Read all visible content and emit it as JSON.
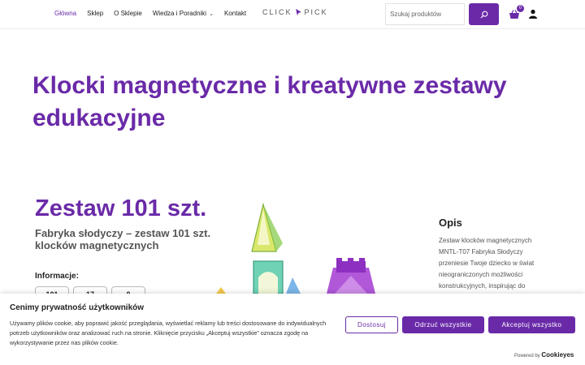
{
  "header": {
    "nav": [
      {
        "label": "Główna"
      },
      {
        "label": "Sklep"
      },
      {
        "label": "O Sklepie"
      },
      {
        "label": "Wiedza i Poradniki"
      },
      {
        "label": "Kontakt"
      }
    ],
    "logo_left": "CLICK",
    "logo_right": "PICK",
    "search_placeholder": "Szukaj produktów",
    "cart_count": "0",
    "accent_color": "#6a2aa8"
  },
  "hero": {
    "title": "Klocki magnetyczne i kreatywne zestawy edukacyjne"
  },
  "product": {
    "title": "Zestaw 101 szt.",
    "subtitle": "Fabryka słodyczy – zestaw 101 szt. klocków magnetycznych",
    "info_label": "Informacje:",
    "info_values": [
      "101",
      "17",
      "0"
    ]
  },
  "description": {
    "title": "Opis",
    "text": "Zestaw klocków magnetycznych MNTL-T07 Fabryka Słodyczy przeniesie Twoje dziecko w świat nieograniczonych możliwości konstrukcyjnych, inspirując do"
  },
  "cookie": {
    "title": "Cenimy prywatność użytkowników",
    "text": "Używamy plików cookie, aby poprawić jakość przeglądania, wyświetlać reklamy lub treści dostosowane do indywidualnych potrzeb użytkowników oraz analizować ruch na stronie. Kliknięcie przycisku „Akceptuj wszystkie” oznacza zgodę na wykorzystywanie przez nas plików cookie.",
    "btn_customize": "Dostosuj",
    "btn_reject": "Odrzuć wszystkie",
    "btn_accept": "Akceptuj wszystko",
    "powered_by": "Powered by",
    "powered_brand": "Cookieyes"
  }
}
